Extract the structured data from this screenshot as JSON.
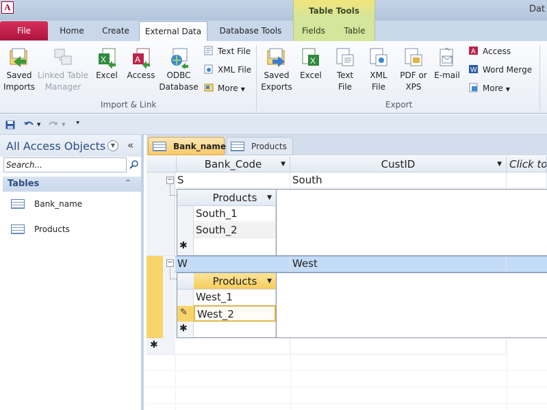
{
  "window": {
    "title": "Dat",
    "app_icon": "A"
  },
  "contextual": {
    "label": "Table Tools"
  },
  "ribbon_tabs": {
    "file": "File",
    "home": "Home",
    "create": "Create",
    "external": "External Data",
    "dbtools": "Database Tools",
    "fields": "Fields",
    "table": "Table"
  },
  "ribbon": {
    "saved_imports": "Saved Imports",
    "linked_table_manager": "Linked Table Manager",
    "excel_import": "Excel",
    "access_import": "Access",
    "odbc": "ODBC Database",
    "text_file": "Text File",
    "xml_file": "XML File",
    "more_import": "More",
    "import_group": "Import & Link",
    "saved_exports": "Saved Exports",
    "excel_export": "Excel",
    "text_file_export": "Text File",
    "xml_file_export": "XML File",
    "pdf_xps": "PDF or XPS",
    "email": "E-mail",
    "access_export": "Access",
    "word_merge": "Word Merge",
    "more_export": "More",
    "export_group": "Export"
  },
  "nav": {
    "title": "All Access Objects",
    "search_placeholder": "Search...",
    "tables_header": "Tables",
    "items": [
      {
        "label": "Bank_name"
      },
      {
        "label": "Products"
      }
    ]
  },
  "doc_tabs": [
    {
      "label": "Bank_name"
    },
    {
      "label": "Products"
    }
  ],
  "grid": {
    "columns": [
      "Bank_Code",
      "CustID",
      "Click to"
    ],
    "rows": [
      {
        "code": "S",
        "custid": "South",
        "sub_header": "Products",
        "sub_items": [
          "South_1",
          "South_2"
        ]
      },
      {
        "code": "W",
        "custid": "West",
        "sub_header": "Products",
        "sub_items": [
          "West_1",
          "West_2"
        ]
      }
    ],
    "new_row_marker": "✱",
    "edit_marker": "✎"
  },
  "colors": {
    "accent_file": "#b81c4a",
    "selected_row": "#c5dcf7",
    "active_tab": "#f9c96a",
    "context_tab": "#d4e59c"
  }
}
